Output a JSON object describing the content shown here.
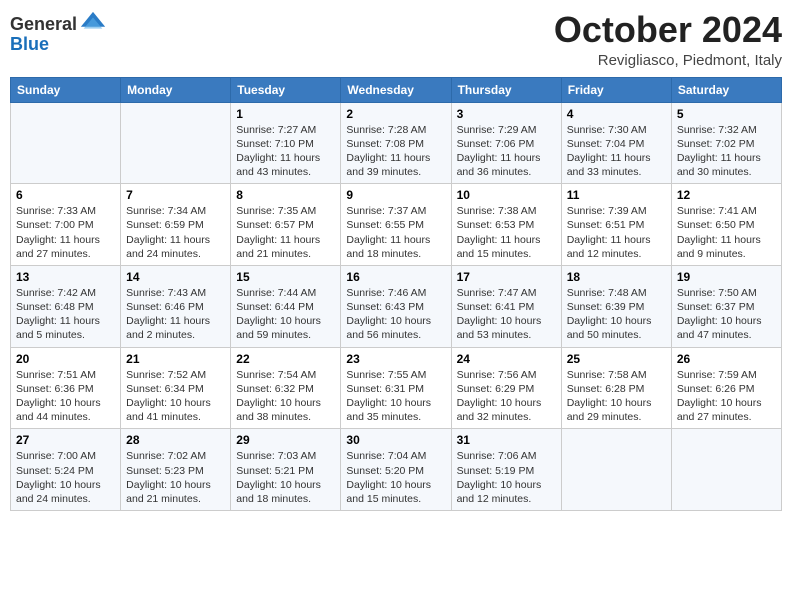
{
  "header": {
    "logo": {
      "line1": "General",
      "line2": "Blue"
    },
    "title": "October 2024",
    "location": "Revigliasco, Piedmont, Italy"
  },
  "days_of_week": [
    "Sunday",
    "Monday",
    "Tuesday",
    "Wednesday",
    "Thursday",
    "Friday",
    "Saturday"
  ],
  "weeks": [
    [
      {
        "day": "",
        "info": ""
      },
      {
        "day": "",
        "info": ""
      },
      {
        "day": "1",
        "info": "Sunrise: 7:27 AM\nSunset: 7:10 PM\nDaylight: 11 hours\nand 43 minutes."
      },
      {
        "day": "2",
        "info": "Sunrise: 7:28 AM\nSunset: 7:08 PM\nDaylight: 11 hours\nand 39 minutes."
      },
      {
        "day": "3",
        "info": "Sunrise: 7:29 AM\nSunset: 7:06 PM\nDaylight: 11 hours\nand 36 minutes."
      },
      {
        "day": "4",
        "info": "Sunrise: 7:30 AM\nSunset: 7:04 PM\nDaylight: 11 hours\nand 33 minutes."
      },
      {
        "day": "5",
        "info": "Sunrise: 7:32 AM\nSunset: 7:02 PM\nDaylight: 11 hours\nand 30 minutes."
      }
    ],
    [
      {
        "day": "6",
        "info": "Sunrise: 7:33 AM\nSunset: 7:00 PM\nDaylight: 11 hours\nand 27 minutes."
      },
      {
        "day": "7",
        "info": "Sunrise: 7:34 AM\nSunset: 6:59 PM\nDaylight: 11 hours\nand 24 minutes."
      },
      {
        "day": "8",
        "info": "Sunrise: 7:35 AM\nSunset: 6:57 PM\nDaylight: 11 hours\nand 21 minutes."
      },
      {
        "day": "9",
        "info": "Sunrise: 7:37 AM\nSunset: 6:55 PM\nDaylight: 11 hours\nand 18 minutes."
      },
      {
        "day": "10",
        "info": "Sunrise: 7:38 AM\nSunset: 6:53 PM\nDaylight: 11 hours\nand 15 minutes."
      },
      {
        "day": "11",
        "info": "Sunrise: 7:39 AM\nSunset: 6:51 PM\nDaylight: 11 hours\nand 12 minutes."
      },
      {
        "day": "12",
        "info": "Sunrise: 7:41 AM\nSunset: 6:50 PM\nDaylight: 11 hours\nand 9 minutes."
      }
    ],
    [
      {
        "day": "13",
        "info": "Sunrise: 7:42 AM\nSunset: 6:48 PM\nDaylight: 11 hours\nand 5 minutes."
      },
      {
        "day": "14",
        "info": "Sunrise: 7:43 AM\nSunset: 6:46 PM\nDaylight: 11 hours\nand 2 minutes."
      },
      {
        "day": "15",
        "info": "Sunrise: 7:44 AM\nSunset: 6:44 PM\nDaylight: 10 hours\nand 59 minutes."
      },
      {
        "day": "16",
        "info": "Sunrise: 7:46 AM\nSunset: 6:43 PM\nDaylight: 10 hours\nand 56 minutes."
      },
      {
        "day": "17",
        "info": "Sunrise: 7:47 AM\nSunset: 6:41 PM\nDaylight: 10 hours\nand 53 minutes."
      },
      {
        "day": "18",
        "info": "Sunrise: 7:48 AM\nSunset: 6:39 PM\nDaylight: 10 hours\nand 50 minutes."
      },
      {
        "day": "19",
        "info": "Sunrise: 7:50 AM\nSunset: 6:37 PM\nDaylight: 10 hours\nand 47 minutes."
      }
    ],
    [
      {
        "day": "20",
        "info": "Sunrise: 7:51 AM\nSunset: 6:36 PM\nDaylight: 10 hours\nand 44 minutes."
      },
      {
        "day": "21",
        "info": "Sunrise: 7:52 AM\nSunset: 6:34 PM\nDaylight: 10 hours\nand 41 minutes."
      },
      {
        "day": "22",
        "info": "Sunrise: 7:54 AM\nSunset: 6:32 PM\nDaylight: 10 hours\nand 38 minutes."
      },
      {
        "day": "23",
        "info": "Sunrise: 7:55 AM\nSunset: 6:31 PM\nDaylight: 10 hours\nand 35 minutes."
      },
      {
        "day": "24",
        "info": "Sunrise: 7:56 AM\nSunset: 6:29 PM\nDaylight: 10 hours\nand 32 minutes."
      },
      {
        "day": "25",
        "info": "Sunrise: 7:58 AM\nSunset: 6:28 PM\nDaylight: 10 hours\nand 29 minutes."
      },
      {
        "day": "26",
        "info": "Sunrise: 7:59 AM\nSunset: 6:26 PM\nDaylight: 10 hours\nand 27 minutes."
      }
    ],
    [
      {
        "day": "27",
        "info": "Sunrise: 7:00 AM\nSunset: 5:24 PM\nDaylight: 10 hours\nand 24 minutes."
      },
      {
        "day": "28",
        "info": "Sunrise: 7:02 AM\nSunset: 5:23 PM\nDaylight: 10 hours\nand 21 minutes."
      },
      {
        "day": "29",
        "info": "Sunrise: 7:03 AM\nSunset: 5:21 PM\nDaylight: 10 hours\nand 18 minutes."
      },
      {
        "day": "30",
        "info": "Sunrise: 7:04 AM\nSunset: 5:20 PM\nDaylight: 10 hours\nand 15 minutes."
      },
      {
        "day": "31",
        "info": "Sunrise: 7:06 AM\nSunset: 5:19 PM\nDaylight: 10 hours\nand 12 minutes."
      },
      {
        "day": "",
        "info": ""
      },
      {
        "day": "",
        "info": ""
      }
    ]
  ]
}
